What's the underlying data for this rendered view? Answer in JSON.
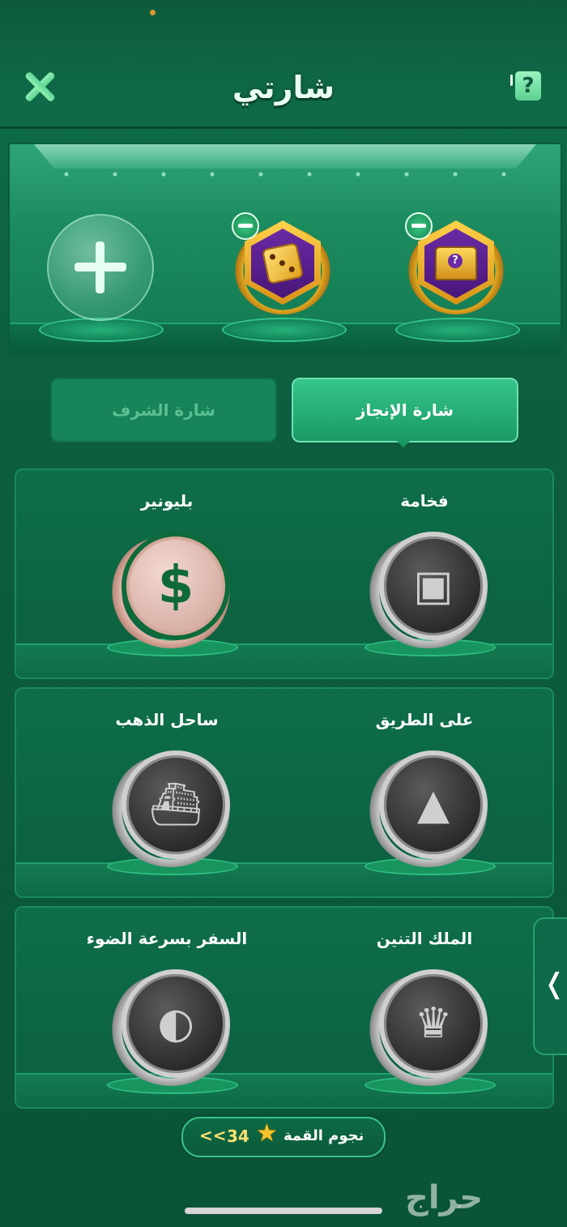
{
  "header": {
    "title": "شارتي",
    "help_symbol": "?"
  },
  "showcase": {
    "equipped": [
      {
        "icon": "dice-badge-icon"
      },
      {
        "icon": "chest-badge-icon"
      }
    ]
  },
  "tabs": {
    "achievement": "شارة الإنجاز",
    "honor": "شارة الشرف",
    "active": "achievement"
  },
  "badges": [
    {
      "name": "فخامة",
      "icon": "treasure-chest-icon",
      "unlocked": false
    },
    {
      "name": "بليونير",
      "icon": "dollar-icon",
      "unlocked": true
    },
    {
      "name": "على الطريق",
      "icon": "road-mountains-icon",
      "unlocked": false
    },
    {
      "name": "ساحل الذهب",
      "icon": "yacht-helicopter-icon",
      "unlocked": false
    },
    {
      "name": "الملك التنين",
      "icon": "dragon-icon",
      "unlocked": false
    },
    {
      "name": "السفر بسرعة الضوء",
      "icon": "sports-car-icon",
      "unlocked": false
    }
  ],
  "stars_bar": {
    "label": "نجوم القمة",
    "count": "34",
    "arrow": "<<"
  },
  "watermark": "حراج",
  "colors": {
    "accent": "#35c58a",
    "background": "#0b5a3b",
    "gold": "#ffe070"
  }
}
